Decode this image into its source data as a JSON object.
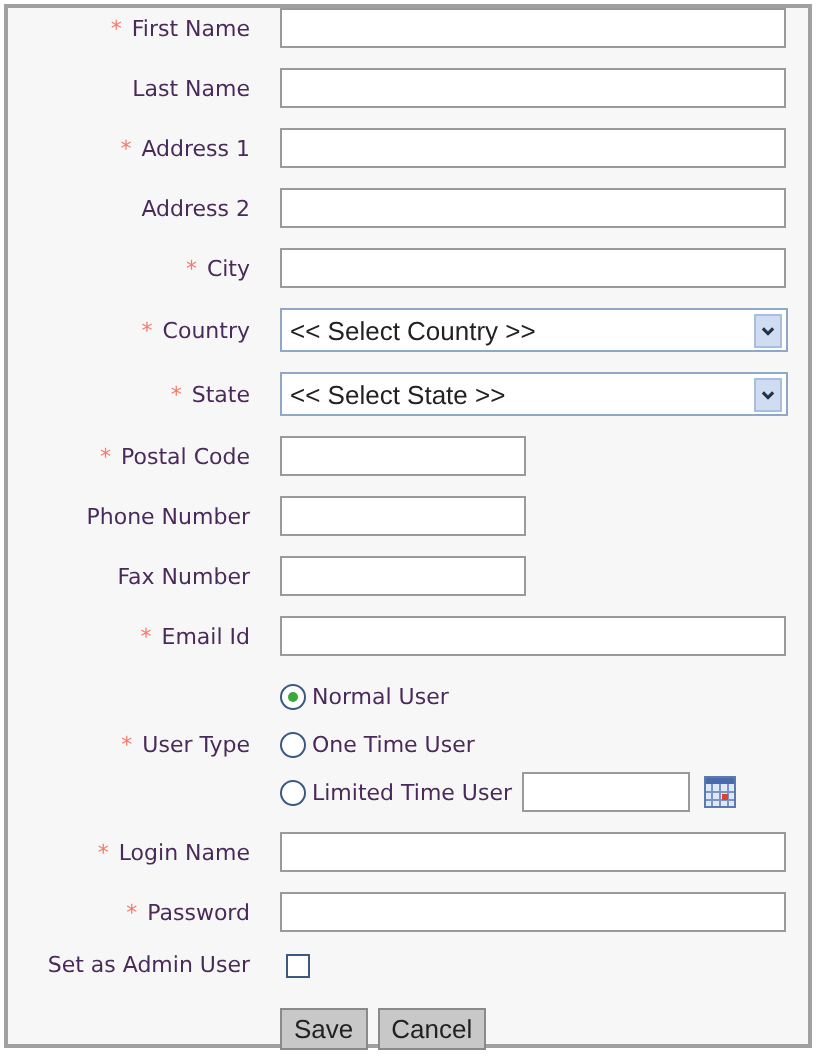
{
  "fields": [
    {
      "kind": "text",
      "label": "First Name",
      "required_mark": "*"
    },
    {
      "kind": "text",
      "label": "Last Name"
    },
    {
      "kind": "text",
      "label": "Address 1",
      "required_mark": "*"
    },
    {
      "kind": "text",
      "label": "Address 2"
    },
    {
      "kind": "text",
      "label": "City",
      "required_mark": "*"
    },
    {
      "kind": "select",
      "label": "Country",
      "required_mark": "*",
      "value": "<< Select Country >>"
    },
    {
      "kind": "select",
      "label": "State",
      "required_mark": "*",
      "value": "<< Select State >>"
    },
    {
      "kind": "short",
      "label": "Postal Code",
      "required_mark": "*"
    },
    {
      "kind": "short",
      "label": "Phone Number"
    },
    {
      "kind": "short",
      "label": "Fax Number"
    },
    {
      "kind": "text",
      "label": "Email Id",
      "required_mark": "*"
    },
    {
      "kind": "radio",
      "label": "User Type",
      "required_mark": "*",
      "options": [
        {
          "label": "Normal User",
          "selected": true,
          "kind": "plain"
        },
        {
          "label": "One Time User",
          "selected": false,
          "kind": "plain"
        },
        {
          "label": "Limited Time User",
          "selected": false,
          "kind": "date"
        }
      ]
    },
    {
      "kind": "text",
      "label": "Login Name",
      "required_mark": "*"
    },
    {
      "kind": "text",
      "label": "Password",
      "required_mark": "*"
    },
    {
      "kind": "checkbox",
      "label": "Set as Admin User",
      "checked": false
    }
  ],
  "buttons": [
    "Save",
    "Cancel"
  ]
}
